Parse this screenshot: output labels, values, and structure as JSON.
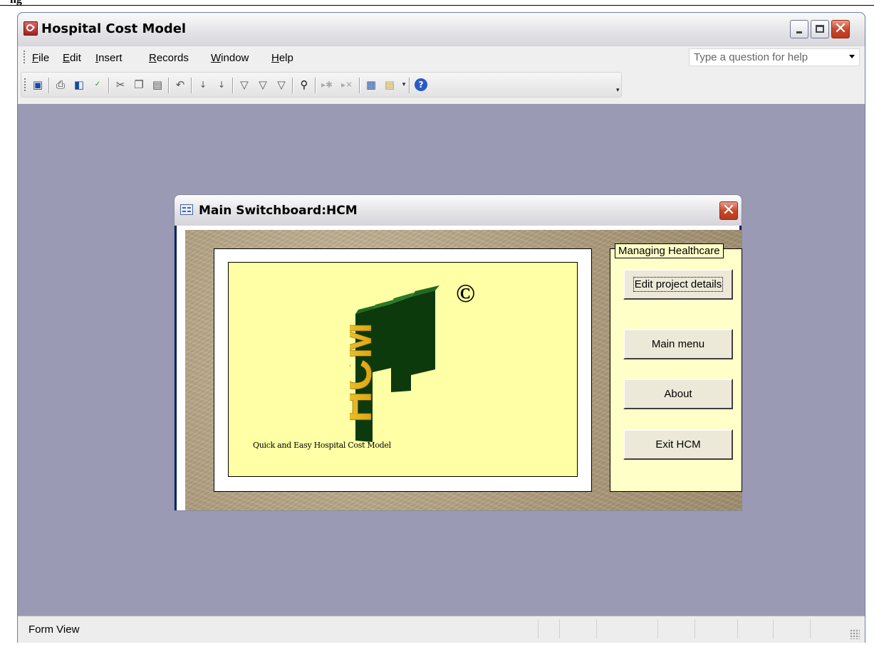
{
  "document_fragment": "ng",
  "app": {
    "title": "Hospital Cost Model"
  },
  "menu": {
    "items": [
      {
        "label": "File",
        "accel": "F"
      },
      {
        "label": "Edit",
        "accel": "E"
      },
      {
        "label": "Insert",
        "accel": "I"
      },
      {
        "label": "Records",
        "accel": "R"
      },
      {
        "label": "Window",
        "accel": "W"
      },
      {
        "label": "Help",
        "accel": "H"
      }
    ],
    "help_placeholder": "Type a question for help"
  },
  "toolbar": {
    "icons": [
      "save-icon",
      "print-icon",
      "print-preview-icon",
      "spelling-icon",
      "cut-icon",
      "copy-icon",
      "paste-icon",
      "undo-icon",
      "sort-ascending-icon",
      "sort-descending-icon",
      "filter-by-selection-icon",
      "filter-by-form-icon",
      "apply-filter-icon",
      "find-icon",
      "new-record-icon",
      "delete-record-icon",
      "database-window-icon",
      "new-object-icon",
      "help-icon"
    ]
  },
  "switchboard": {
    "title": "Main Switchboard:HCM",
    "logo_text": "HCM",
    "copyright_symbol": "©",
    "tagline": "Quick and Easy Hospital Cost Model",
    "group_label": "Managing Healthcare",
    "buttons": [
      {
        "label": "Edit project details",
        "accel": "E"
      },
      {
        "label": "Main menu",
        "accel": ""
      },
      {
        "label": "About",
        "accel": "A"
      },
      {
        "label": "Exit HCM",
        "accel": "E"
      }
    ]
  },
  "status": {
    "text": "Form View"
  },
  "colors": {
    "workspace": "#9b9ab5",
    "logo_panel": "#ffffa6",
    "side_panel": "#ffffc8",
    "logo_gold": "#f2c21a",
    "logo_dark": "#0d3a0d"
  }
}
